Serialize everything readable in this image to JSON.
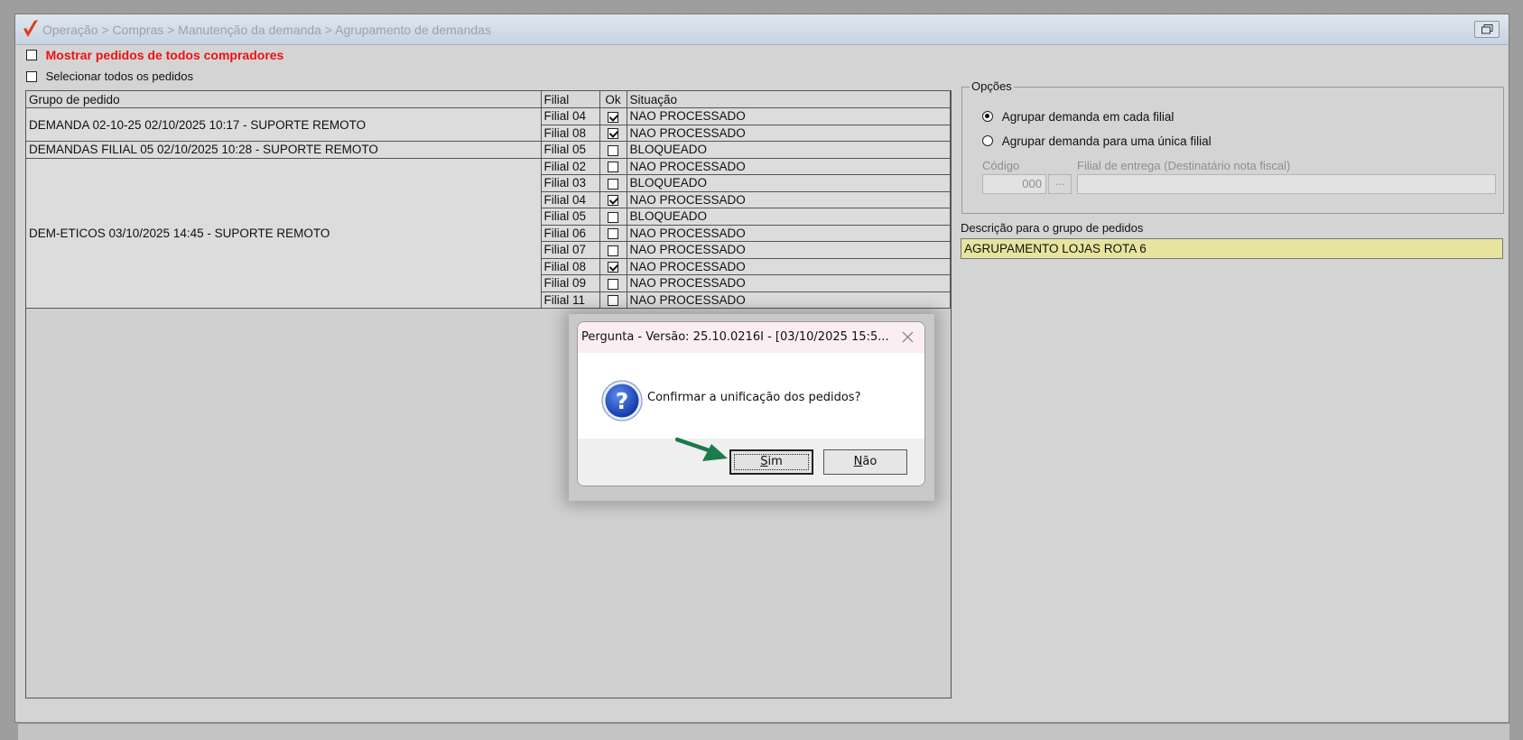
{
  "window": {
    "title": "Operação > Compras > Manutenção da demanda > Agrupamento de demandas"
  },
  "options": {
    "show_all_buyers": "Mostrar pedidos de todos compradores",
    "select_all_orders": "Selecionar todos os pedidos"
  },
  "table": {
    "columns": [
      "Grupo de pedido",
      "Filial",
      "Ok",
      "Situação"
    ],
    "groups": [
      {
        "name": "DEMANDA 02-10-25 02/10/2025 10:17 - SUPORTE REMOTO",
        "rows": [
          {
            "filial": "Filial 04",
            "ok": true,
            "situacao": "NAO PROCESSADO"
          },
          {
            "filial": "Filial 08",
            "ok": true,
            "situacao": "NAO PROCESSADO"
          }
        ]
      },
      {
        "name": "DEMANDAS FILIAL 05 02/10/2025 10:28 - SUPORTE REMOTO",
        "rows": [
          {
            "filial": "Filial 05",
            "ok": false,
            "situacao": "BLOQUEADO"
          }
        ]
      },
      {
        "name": "DEM-ETICOS 03/10/2025 14:45 - SUPORTE REMOTO",
        "rows": [
          {
            "filial": "Filial 02",
            "ok": false,
            "situacao": "NAO PROCESSADO"
          },
          {
            "filial": "Filial 03",
            "ok": false,
            "situacao": "BLOQUEADO"
          },
          {
            "filial": "Filial 04",
            "ok": true,
            "situacao": "NAO PROCESSADO"
          },
          {
            "filial": "Filial 05",
            "ok": false,
            "situacao": "BLOQUEADO"
          },
          {
            "filial": "Filial 06",
            "ok": false,
            "situacao": "NAO PROCESSADO"
          },
          {
            "filial": "Filial 07",
            "ok": false,
            "situacao": "NAO PROCESSADO"
          },
          {
            "filial": "Filial 08",
            "ok": true,
            "situacao": "NAO PROCESSADO"
          },
          {
            "filial": "Filial 09",
            "ok": false,
            "situacao": "NAO PROCESSADO"
          },
          {
            "filial": "Filial 11",
            "ok": false,
            "situacao": "NAO PROCESSADO"
          }
        ]
      }
    ]
  },
  "panel": {
    "legend": "Opções",
    "radio_each": "Agrupar demanda em cada filial",
    "radio_single": "Agrupar demanda para uma única filial",
    "selected_radio": "each",
    "codigo_label": "Código",
    "codigo_value": "000",
    "lookup_label": "...",
    "filial_entrega_label": "Filial de entrega (Destinatário nota fiscal)",
    "filial_entrega_value": "",
    "descricao_label": "Descrição para o grupo de pedidos",
    "descricao_value": "AGRUPAMENTO LOJAS ROTA 6"
  },
  "dialog": {
    "title": "Pergunta - Versão: 25.10.0216I - [03/10/2025 15:5...",
    "message": "Confirmar a unificação dos pedidos?",
    "yes_rest": "im",
    "yes_key": "S",
    "no_key": "N",
    "no_rest": "ão"
  },
  "colors": {
    "red_label": "#ee1111",
    "description_bg": "#e7e49f",
    "arrow": "#1d7a4a",
    "icon_blue": "#1f56c8"
  }
}
